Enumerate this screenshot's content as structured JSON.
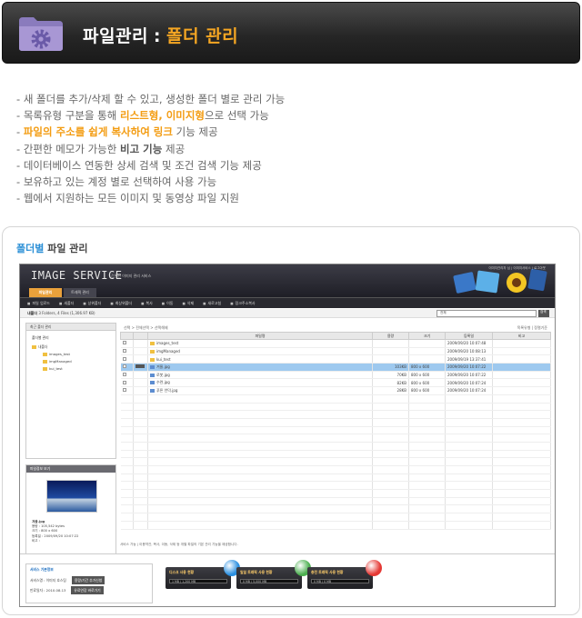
{
  "header": {
    "title": "파일관리",
    "separator": ":",
    "subtitle": "폴더 관리",
    "icon": "gear-folder-icon",
    "accent": "#f5a623"
  },
  "features": [
    {
      "parts": [
        {
          "t": "새 폴더를 추가/삭제 할 수 있고, 생성한 폴더 별로 관리 가능"
        }
      ]
    },
    {
      "parts": [
        {
          "t": "목록유형 구분을 통해 "
        },
        {
          "t": "리스트형, 이미지형",
          "s": "or"
        },
        {
          "t": "으로 선택 가능"
        }
      ]
    },
    {
      "parts": [
        {
          "t": "파일의 주소를 쉽게 복사하여 링크",
          "s": "or"
        },
        {
          "t": " 기능 제공"
        }
      ]
    },
    {
      "parts": [
        {
          "t": "간편한 메모가 가능한 "
        },
        {
          "t": "비고 기능",
          "s": "b"
        },
        {
          "t": " 제공"
        }
      ]
    },
    {
      "parts": [
        {
          "t": "데이터베이스 연동한 상세 검색 및 조건 검색 기능 제공"
        }
      ]
    },
    {
      "parts": [
        {
          "t": "보유하고 있는 계정 별로 선택하여 사용 가능"
        }
      ]
    },
    {
      "parts": [
        {
          "t": "웹에서 지원하는 모든 이미지 및 동영상 파일 지원"
        }
      ]
    }
  ],
  "panel": {
    "title_highlight": "폴더별",
    "title_rest": " 파일 관리"
  },
  "app": {
    "logo": "IMAGE SERVICE",
    "logo_sub": "간편한 이미지 관리 서비스",
    "util": "이미지관리자 님 | 이미지서비스 | 로그아웃",
    "tabs": [
      "파일관리",
      "트래픽 관리"
    ],
    "toolbar": [
      "파일 업로드",
      "새폴더",
      "상위폴더",
      "최상위폴더",
      "복사",
      "이동",
      "삭제",
      "새로고침",
      "링크주소복사"
    ],
    "path_label": "내폴더",
    "path_info": "3 Folders, 4 Files (1,306.97 KB)",
    "search_option": "전체",
    "search_button": "검색",
    "sidebar_title": "최근 폴더 관리",
    "sidebar_section": "폴더별 관리",
    "tree": {
      "root": "내폴더",
      "children": [
        "images_test",
        "imgManaged",
        "kui_test"
      ]
    },
    "preview_title": "파일정보 보기",
    "preview": {
      "name": "겨울.jpg",
      "rows": [
        "용량 : 105,542 bytes",
        "크기 : 800 x 600",
        "등록일 : 2009/09/20 10:07:22",
        "비고 :"
      ]
    },
    "list_bar": "선택 > 전체선택 > 선택해제",
    "list_bar_right": "목록유형 | 정렬기준",
    "columns": [
      "",
      "",
      "파일명",
      "용량",
      "크기",
      "등록일",
      "비고"
    ],
    "files": [
      {
        "name": "images_test",
        "kind": "folder",
        "size": "",
        "dim": "",
        "date": "2009/09/20 10:07:48",
        "memo": "",
        "sel": false
      },
      {
        "name": "imgManaged",
        "kind": "folder",
        "size": "",
        "dim": "",
        "date": "2009/09/20 10:08:13",
        "memo": "",
        "sel": false
      },
      {
        "name": "kui_test",
        "kind": "folder",
        "size": "",
        "dim": "",
        "date": "2009/09/19 13:37:41",
        "memo": "",
        "sel": false
      },
      {
        "name": "겨울.jpg",
        "kind": "image",
        "size": "103KB",
        "dim": "800 x 600",
        "date": "2009/09/20 10:07:22",
        "memo": "",
        "sel": true
      },
      {
        "name": "로봇.jpg",
        "kind": "image",
        "size": "70KB",
        "dim": "800 x 600",
        "date": "2009/09/20 10:07:22",
        "memo": "",
        "sel": false
      },
      {
        "name": "수련.jpg",
        "kind": "image",
        "size": "82KB",
        "dim": "800 x 600",
        "date": "2009/09/20 10:07:24",
        "memo": "",
        "sel": false
      },
      {
        "name": "푸른 언덕.jpg",
        "kind": "image",
        "size": "28KB",
        "dim": "800 x 600",
        "date": "2009/09/20 10:07:24",
        "memo": "",
        "sel": false
      }
    ],
    "list_footer": "서비스 가능 | 이용약관, 복사, 이동, 삭제 등 개별 파일의 기본 관리 기능을 제공합니다.",
    "account": {
      "title": "서비스 기본정보",
      "rows": [
        {
          "label": "서비스명 :",
          "value": "이미지 호스팅",
          "button": "용량/기간 추가신청"
        },
        {
          "label": "만료일자 :",
          "value": "2010.08.13",
          "button": "유료연장 바로가기"
        }
      ]
    },
    "gauges": [
      {
        "title": "디스크 사용 현황",
        "value": "1 MB / 1,200 MB",
        "color": "#2a8fe0"
      },
      {
        "title": "일일 트래픽 사용 현황",
        "value": "0 MB / 5,000 MB",
        "color": "#4caf50"
      },
      {
        "title": "충전 트래픽 사용 현황",
        "value": "0 MB / 0 MB",
        "color": "#e53935"
      }
    ]
  }
}
